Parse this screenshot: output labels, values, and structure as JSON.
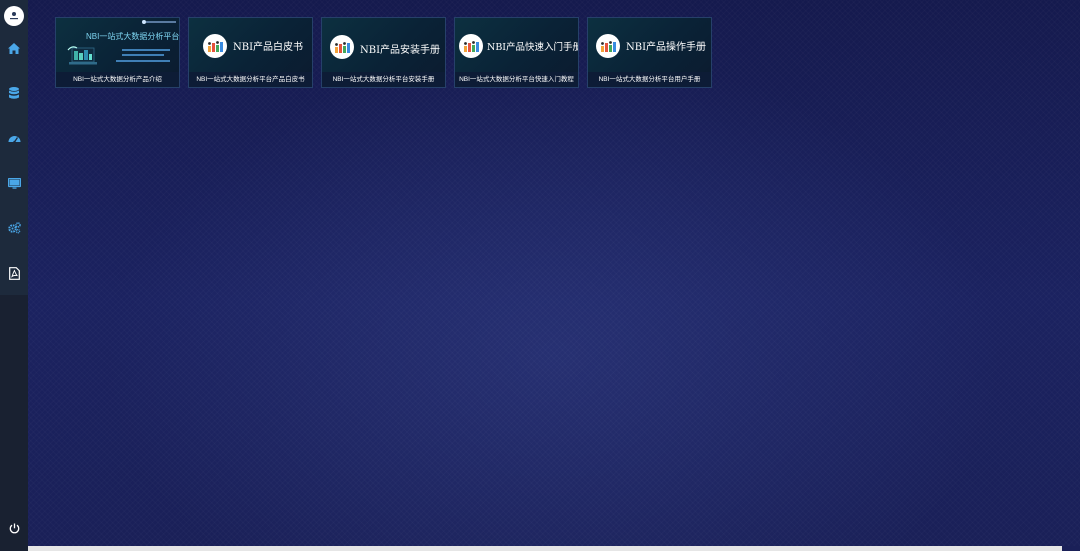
{
  "sidebar": {
    "items": [
      {
        "icon": "home-icon"
      },
      {
        "icon": "database-icon"
      },
      {
        "icon": "dashboard-icon"
      },
      {
        "icon": "monitor-icon"
      },
      {
        "icon": "gears-icon"
      },
      {
        "icon": "pdf-file-icon"
      }
    ],
    "footer_icon": "power-icon"
  },
  "cards": [
    {
      "thumb_title": "NBI一站式大数据分析平台",
      "caption": "NBI一站式大数据分析产品介绍"
    },
    {
      "thumb_title": "NBI产品白皮书",
      "caption": "NBI一站式大数据分析平台产品白皮书"
    },
    {
      "thumb_title": "NBI产品安装手册",
      "caption": "NBI一站式大数据分析平台安装手册"
    },
    {
      "thumb_title": "NBI产品快速入门手册",
      "caption": "NBI一站式大数据分析平台快速入门教程"
    },
    {
      "thumb_title": "NBI产品操作手册",
      "caption": "NBI一站式大数据分析平台用户手册"
    }
  ],
  "colors": {
    "sidebar": "#1d2a3c",
    "sidebar_icon": "#4aa7e8",
    "background": "#1a2058",
    "card_border": "#26406a"
  }
}
